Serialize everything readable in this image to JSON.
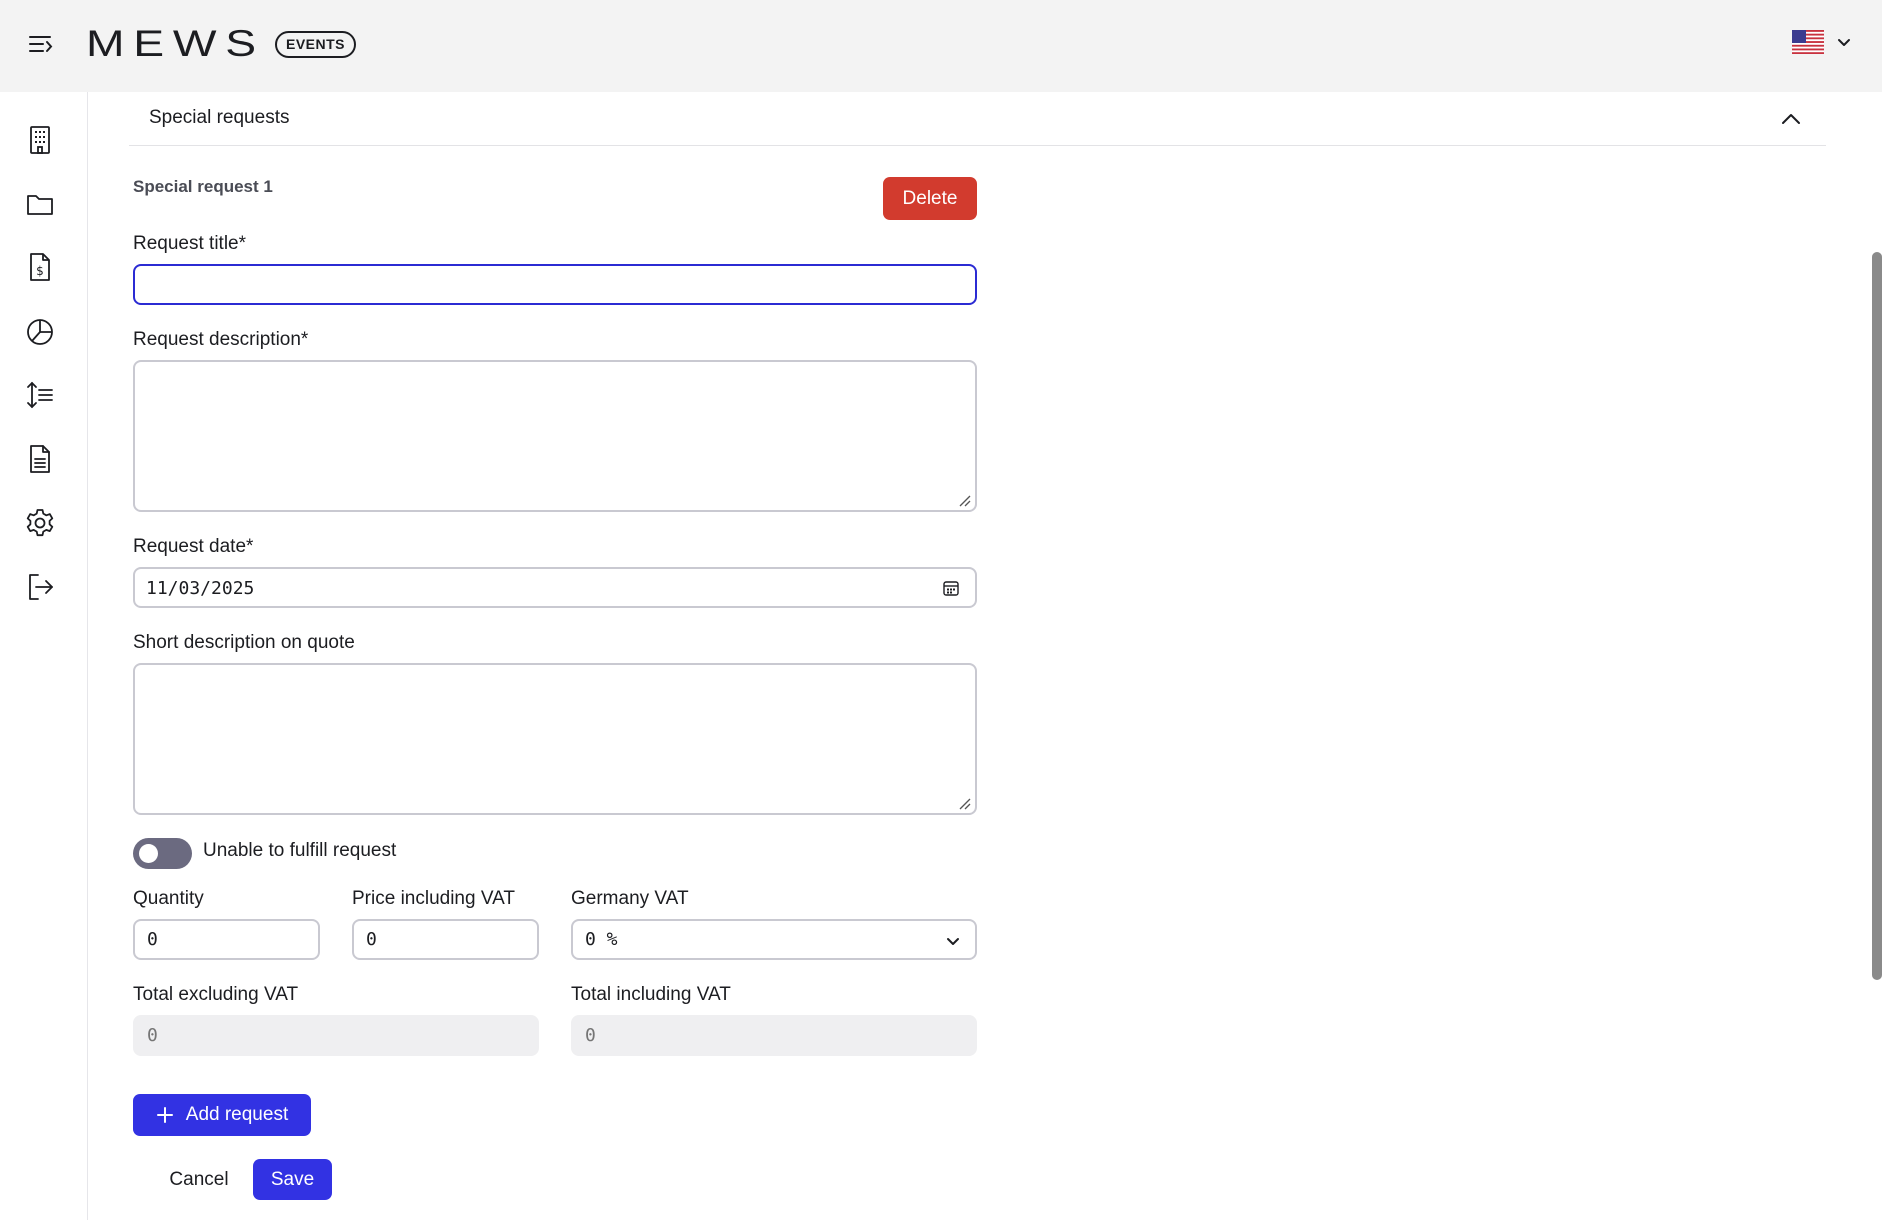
{
  "header": {
    "logo_text": "MEWS",
    "badge": "EVENTS",
    "language_flag": "us-flag-icon"
  },
  "sidebar": {
    "items": [
      {
        "icon": "building-icon"
      },
      {
        "icon": "folder-icon"
      },
      {
        "icon": "invoice-icon"
      },
      {
        "icon": "pie-chart-icon"
      },
      {
        "icon": "sort-list-icon"
      },
      {
        "icon": "document-icon"
      },
      {
        "icon": "gear-icon"
      },
      {
        "icon": "logout-icon"
      }
    ]
  },
  "section": {
    "title": "Special requests"
  },
  "request": {
    "heading": "Special request 1",
    "delete_label": "Delete",
    "title_label": "Request title*",
    "title_value": "",
    "description_label": "Request description*",
    "description_value": "",
    "date_label": "Request date*",
    "date_value": "11/03/2025",
    "short_desc_label": "Short description on quote",
    "short_desc_value": "",
    "unable_label": "Unable to fulfill request",
    "unable_checked": false,
    "quantity_label": "Quantity",
    "quantity_value": "0",
    "price_label": "Price including VAT",
    "price_value": "0",
    "vat_label": "Germany VAT",
    "vat_value": "0 %",
    "total_excl_label": "Total excluding VAT",
    "total_excl_placeholder": "0",
    "total_incl_label": "Total including VAT",
    "total_incl_placeholder": "0"
  },
  "actions": {
    "add_label": "Add request",
    "cancel_label": "Cancel",
    "save_label": "Save"
  },
  "colors": {
    "primary": "#3232e3",
    "danger": "#d23b2e",
    "focus_border": "#2b2bd3"
  }
}
